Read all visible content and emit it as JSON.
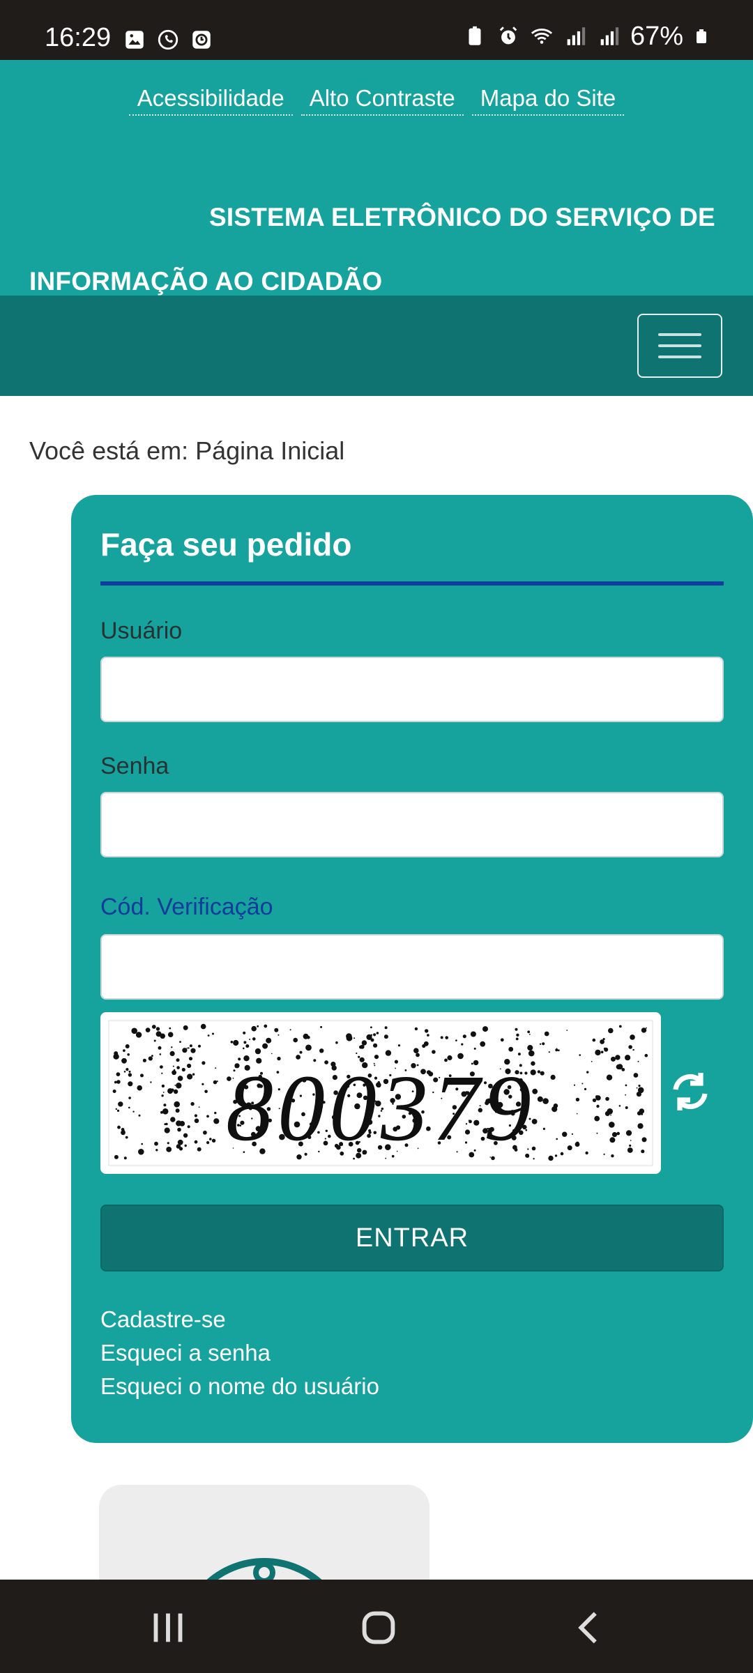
{
  "status_bar": {
    "time": "16:29",
    "battery": "67%"
  },
  "header": {
    "top_links": [
      "Acessibilidade",
      "Alto Contraste",
      "Mapa do Site"
    ],
    "title": "SISTEMA ELETRÔNICO DO SERVIÇO DE INFORMAÇÃO AO CIDADÃO"
  },
  "breadcrumb": "Você está em: Página Inicial",
  "form": {
    "title": "Faça seu pedido",
    "user_label": "Usuário",
    "user_value": "",
    "password_label": "Senha",
    "password_value": "",
    "code_label": "Cód. Verificação",
    "code_value": "",
    "captcha_text": "800379",
    "submit_label": "ENTRAR",
    "links": [
      "Cadastre-se",
      "Esqueci a senha",
      "Esqueci o nome do usuário"
    ]
  },
  "colors": {
    "primary": "#17a39d",
    "dark": "#0f7372",
    "accent_rule": "#0f3f9c"
  }
}
